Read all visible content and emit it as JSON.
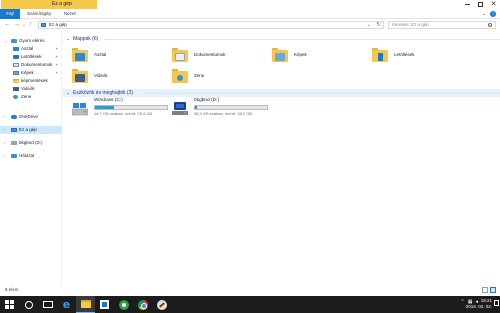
{
  "window": {
    "title": "Ez a gép",
    "colors": {
      "accent": "#1979CA",
      "selection": "#CCE8FF",
      "group_header": "#1E3287",
      "drive_bar": "#26A0DA"
    }
  },
  "ribbon": {
    "tabs": [
      "Fájl",
      "Számítógép",
      "Nézet"
    ]
  },
  "address": {
    "path": "Ez a gép",
    "search_placeholder": "Keresés: Ez a gép"
  },
  "sidebar": {
    "items": [
      {
        "label": "Gyors elérés",
        "icon": "star-icon"
      },
      {
        "label": "Asztal",
        "icon": "desktop-icon",
        "pinned": true
      },
      {
        "label": "Letöltések",
        "icon": "download-icon",
        "pinned": true
      },
      {
        "label": "Dokumentumok",
        "icon": "document-icon",
        "pinned": true
      },
      {
        "label": "Képek",
        "icon": "pictures-icon",
        "pinned": true
      },
      {
        "label": "képmentések",
        "icon": "folder-icon"
      },
      {
        "label": "Videók",
        "icon": "video-icon"
      },
      {
        "label": "Zene",
        "icon": "music-icon"
      },
      {
        "label": "OneDrive",
        "icon": "cloud-icon"
      },
      {
        "label": "Ez a gép",
        "icon": "computer-icon",
        "selected": true
      },
      {
        "label": "bkgbnd (D:)",
        "icon": "drive-icon"
      },
      {
        "label": "Hálózat",
        "icon": "network-icon"
      }
    ]
  },
  "content": {
    "folders_header": "Mappák (6)",
    "devices_header": "Eszközök és meghajtók (2)",
    "folders": [
      {
        "label": "Asztal",
        "icon": "desktop-folder-icon"
      },
      {
        "label": "Dokumentumok",
        "icon": "documents-folder-icon"
      },
      {
        "label": "Képek",
        "icon": "pictures-folder-icon"
      },
      {
        "label": "Letöltések",
        "icon": "downloads-folder-icon"
      },
      {
        "label": "Videók",
        "icon": "videos-folder-icon"
      },
      {
        "label": "Zene",
        "icon": "music-folder-icon"
      }
    ],
    "drives": [
      {
        "name": "Windows (C:)",
        "info": "18,7 GB szabad, méret: 25,4 GB",
        "used_fraction": 0.26,
        "icon": "windows-drive-icon"
      },
      {
        "name": "bkgbnd (D:)",
        "info": "38,3 GB szabad, méret: 38,2 GB",
        "used_fraction": 0.03,
        "icon": "external-drive-icon"
      }
    ]
  },
  "status": {
    "items_text": "8 elem"
  },
  "taskbar": {
    "time": "19:21",
    "date": "2016. 02. 02."
  }
}
